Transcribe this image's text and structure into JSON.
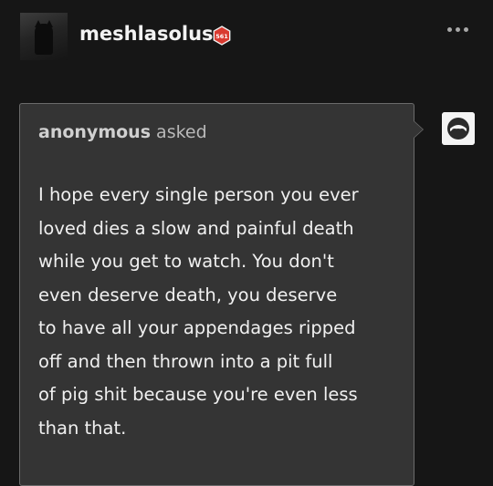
{
  "post": {
    "username": "meshlasolus",
    "badge_text": "561",
    "badge_color": "#d93a30",
    "more_icon": "ellipsis-icon"
  },
  "ask": {
    "asker": "anonymous",
    "asked_label": "asked",
    "body_lines": [
      "I hope every single person you ever",
      "loved dies a slow and painful death",
      "while you get to watch. You don't",
      "even deserve death, you deserve",
      "to have all your appendages ripped",
      "off and then thrown into a pit full",
      "of pig shit because you're even less",
      "than that."
    ],
    "asker_avatar_icon": "anonymous-mask-icon"
  }
}
